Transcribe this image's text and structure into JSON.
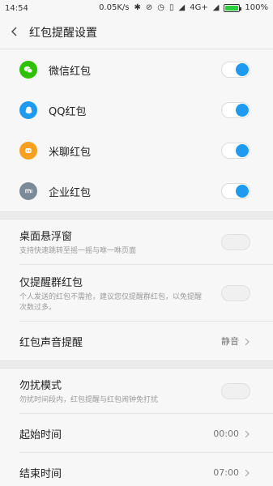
{
  "status": {
    "time": "14:54",
    "speed": "0.05K/s",
    "network": "4G+",
    "battery": "100%",
    "battery_level": 1.0,
    "icons": [
      "bluetooth-icon",
      "mute-icon",
      "alarm-icon",
      "vibrate-icon",
      "signal-icon",
      "signal-icon"
    ]
  },
  "header": {
    "title": "红包提醒设置",
    "back_icon": "chevron-left-icon"
  },
  "apps": [
    {
      "label": "微信红包",
      "icon": "wechat-icon",
      "color": "#2dc100",
      "on": true
    },
    {
      "label": "QQ红包",
      "icon": "qq-icon",
      "color": "#1e9bf0",
      "on": true
    },
    {
      "label": "米聊红包",
      "icon": "miliao-icon",
      "color": "#f7a020",
      "on": true
    },
    {
      "label": "企业红包",
      "icon": "mi-icon",
      "color": "#7b8a99",
      "on": true
    }
  ],
  "settings": {
    "float_window": {
      "label": "桌面悬浮窗",
      "desc": "支持快速跳转至摇一摇与咻一咻页面",
      "on": false
    },
    "group_only": {
      "label": "仅提醒群红包",
      "desc": "个人发送的红包不需抢，建议您仅提醒群红包，以免提醒次数过多。",
      "on": false
    },
    "sound": {
      "label": "红包声音提醒",
      "value": "静音"
    }
  },
  "dnd": {
    "mode": {
      "label": "勿扰模式",
      "desc": "勿扰时间段内，红包提醒与红包闹钟免打扰",
      "on": false
    },
    "start": {
      "label": "起始时间",
      "value": "00:00"
    },
    "end": {
      "label": "结束时间",
      "value": "07:00"
    }
  },
  "colors": {
    "toggle_on": "#1e9bf0",
    "background": "#f7f7f7"
  }
}
